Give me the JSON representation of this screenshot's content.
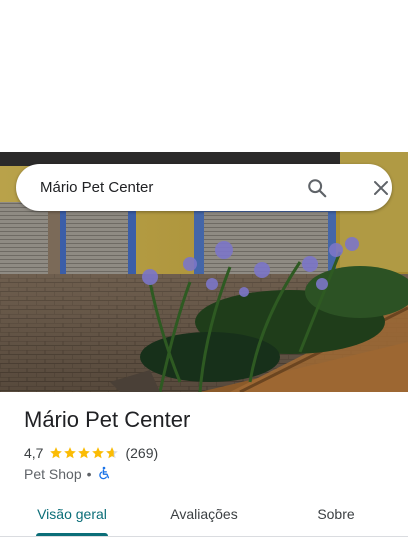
{
  "search": {
    "query": "Mário Pet Center"
  },
  "place": {
    "name": "Mário Pet Center",
    "rating": "4,7",
    "review_count": "(269)",
    "category": "Pet Shop",
    "separator": "•",
    "stars_filled_fraction": 0.94
  },
  "tabs": [
    {
      "label": "Visão geral",
      "active": true
    },
    {
      "label": "Avaliações",
      "active": false
    },
    {
      "label": "Sobre",
      "active": false
    }
  ],
  "icons": {
    "search": "search-icon",
    "close": "close-icon",
    "accessibility": "wheelchair-icon",
    "star": "star-icon"
  },
  "colors": {
    "accent": "#0b6e78",
    "star": "#fbbc04",
    "accessibility": "#1a73e8"
  }
}
